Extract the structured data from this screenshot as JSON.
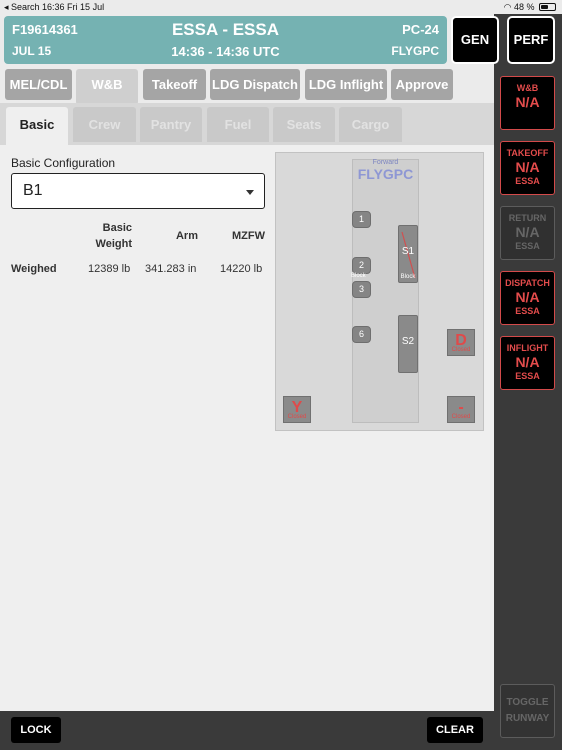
{
  "status_bar": {
    "left": "◂ Search  16:36  Fri 15 Jul",
    "right": "48 %"
  },
  "flight": {
    "id": "F19614361",
    "date": "JUL 15",
    "route": "ESSA - ESSA",
    "time": "14:36 - 14:36 UTC",
    "type": "PC-24",
    "registration": "FLYGPC"
  },
  "top_buttons": {
    "gen": "GEN",
    "perf": "PERF"
  },
  "main_tabs": [
    {
      "label": "MEL/CDL"
    },
    {
      "label": "W&B"
    },
    {
      "label": "Takeoff"
    },
    {
      "label": "LDG Dispatch"
    },
    {
      "label": "LDG Inflight"
    },
    {
      "label": "Approve"
    }
  ],
  "sub_tabs": [
    {
      "label": "Basic"
    },
    {
      "label": "Crew"
    },
    {
      "label": "Pantry"
    },
    {
      "label": "Fuel"
    },
    {
      "label": "Seats"
    },
    {
      "label": "Cargo"
    }
  ],
  "basic": {
    "config_label": "Basic Configuration",
    "config_value": "B1",
    "headers": {
      "basic_weight": "Basic\nWeight",
      "arm": "Arm",
      "mzfw": "MZFW"
    },
    "row": {
      "label": "Weighed",
      "basic_weight": "12389 lb",
      "arm": "341.283 in",
      "mzfw": "14220 lb"
    }
  },
  "diagram": {
    "forward": "Forward",
    "brand": "FLYGPC",
    "seats": [
      "1",
      "2",
      "3",
      "6"
    ],
    "seat2_tag": "Block",
    "s1": "S1",
    "s1_tag": "Block",
    "s2": "S2",
    "d_box": "D",
    "d_sub": "Closed",
    "y_box": "Y",
    "y_sub": "Closed",
    "dash_box": "-",
    "dash_sub": "Closed"
  },
  "status_boxes": [
    {
      "title": "W&B",
      "value": "N/A",
      "airport": ""
    },
    {
      "title": "TAKEOFF",
      "value": "N/A",
      "airport": "ESSA"
    },
    {
      "title": "RETURN",
      "value": "N/A",
      "airport": "ESSA"
    },
    {
      "title": "DISPATCH",
      "value": "N/A",
      "airport": "ESSA"
    },
    {
      "title": "INFLIGHT",
      "value": "N/A",
      "airport": "ESSA"
    }
  ],
  "toggle_runway": "TOGGLE\nRUNWAY",
  "bottom": {
    "lock": "LOCK",
    "clear": "CLEAR"
  },
  "colors": {
    "flight_header": "#75b2b2",
    "alert_red": "#e34c4c",
    "brand_blue": "#8e97d4"
  }
}
